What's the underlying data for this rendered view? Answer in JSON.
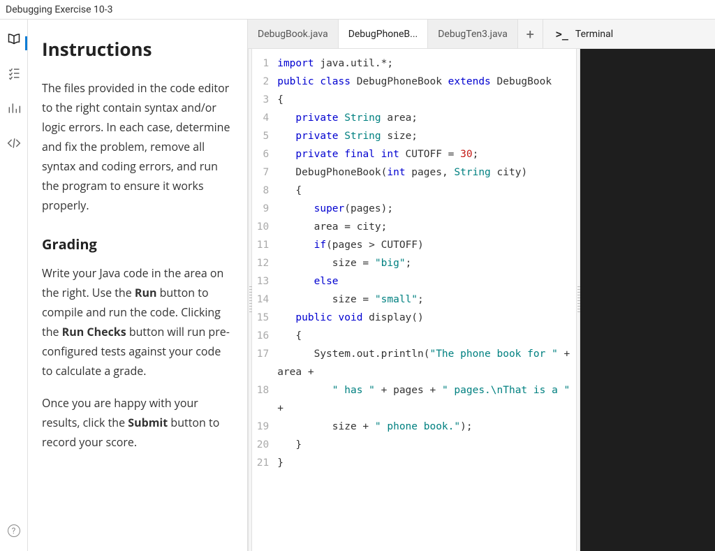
{
  "titlebar": {
    "title": "Debugging Exercise 10-3"
  },
  "iconbar": {
    "items": [
      "book",
      "checklist",
      "chart",
      "code"
    ]
  },
  "instructions": {
    "heading": "Instructions",
    "para1": "The files provided in the code editor to the right contain syntax and/or logic errors. In each case, determine and fix the problem, remove all syntax and coding errors, and run the program to ensure it works properly.",
    "grading_heading": "Grading",
    "para2_pre": "Write your Java code in the area on the right. Use the ",
    "para2_run": "Run",
    "para2_mid": " button to compile and run the code. Clicking the ",
    "para2_runchecks": "Run Checks",
    "para2_post": " button will run pre-configured tests against your code to calculate a grade.",
    "para3_pre": "Once you are happy with your results, click the ",
    "para3_submit": "Submit",
    "para3_post": " button to record your score."
  },
  "tabs": {
    "t1": "DebugBook.java",
    "t2": "DebugPhoneB...",
    "t3": "DebugTen3.java",
    "terminal": "Terminal"
  },
  "code": {
    "lines": [
      {
        "n": "1",
        "segs": [
          {
            "c": "kw",
            "t": "import"
          },
          {
            "c": "",
            "t": " java.util.*;"
          }
        ]
      },
      {
        "n": "2",
        "segs": [
          {
            "c": "kw",
            "t": "public class"
          },
          {
            "c": "",
            "t": " DebugPhoneBook "
          },
          {
            "c": "kw",
            "t": "extends"
          },
          {
            "c": "",
            "t": " DebugBook"
          }
        ]
      },
      {
        "n": "3",
        "segs": [
          {
            "c": "",
            "t": "{"
          }
        ]
      },
      {
        "n": "4",
        "segs": [
          {
            "c": "",
            "t": "   "
          },
          {
            "c": "kw",
            "t": "private"
          },
          {
            "c": "",
            "t": " "
          },
          {
            "c": "type",
            "t": "String"
          },
          {
            "c": "",
            "t": " area;"
          }
        ]
      },
      {
        "n": "5",
        "segs": [
          {
            "c": "",
            "t": "   "
          },
          {
            "c": "kw",
            "t": "private"
          },
          {
            "c": "",
            "t": " "
          },
          {
            "c": "type",
            "t": "String"
          },
          {
            "c": "",
            "t": " size;"
          }
        ]
      },
      {
        "n": "6",
        "segs": [
          {
            "c": "",
            "t": "   "
          },
          {
            "c": "kw",
            "t": "private final int"
          },
          {
            "c": "",
            "t": " CUTOFF = "
          },
          {
            "c": "num",
            "t": "30"
          },
          {
            "c": "",
            "t": ";"
          }
        ]
      },
      {
        "n": "7",
        "segs": [
          {
            "c": "",
            "t": "   DebugPhoneBook("
          },
          {
            "c": "kw",
            "t": "int"
          },
          {
            "c": "",
            "t": " pages, "
          },
          {
            "c": "type",
            "t": "String"
          },
          {
            "c": "",
            "t": " city)"
          }
        ]
      },
      {
        "n": "8",
        "segs": [
          {
            "c": "",
            "t": "   {"
          }
        ]
      },
      {
        "n": "9",
        "segs": [
          {
            "c": "",
            "t": "      "
          },
          {
            "c": "kw",
            "t": "super"
          },
          {
            "c": "",
            "t": "(pages);"
          }
        ]
      },
      {
        "n": "10",
        "segs": [
          {
            "c": "",
            "t": "      area = city;"
          }
        ]
      },
      {
        "n": "11",
        "segs": [
          {
            "c": "",
            "t": "      "
          },
          {
            "c": "kw",
            "t": "if"
          },
          {
            "c": "",
            "t": "(pages > CUTOFF)"
          }
        ]
      },
      {
        "n": "12",
        "segs": [
          {
            "c": "",
            "t": "         size = "
          },
          {
            "c": "str",
            "t": "\"big\""
          },
          {
            "c": "",
            "t": ";"
          }
        ]
      },
      {
        "n": "13",
        "segs": [
          {
            "c": "",
            "t": "      "
          },
          {
            "c": "kw",
            "t": "else"
          }
        ]
      },
      {
        "n": "14",
        "segs": [
          {
            "c": "",
            "t": "         size = "
          },
          {
            "c": "str",
            "t": "\"small\""
          },
          {
            "c": "",
            "t": ";"
          }
        ]
      },
      {
        "n": "15",
        "segs": [
          {
            "c": "",
            "t": "   "
          },
          {
            "c": "kw",
            "t": "public void"
          },
          {
            "c": "",
            "t": " display()"
          }
        ]
      },
      {
        "n": "16",
        "segs": [
          {
            "c": "",
            "t": "   {"
          }
        ]
      },
      {
        "n": "17",
        "segs": [
          {
            "c": "",
            "t": "      System.out.println("
          },
          {
            "c": "str",
            "t": "\"The phone book for \""
          },
          {
            "c": "",
            "t": " + "
          }
        ]
      },
      {
        "n": "",
        "segs": [
          {
            "c": "",
            "t": "area +"
          }
        ]
      },
      {
        "n": "18",
        "segs": [
          {
            "c": "",
            "t": "         "
          },
          {
            "c": "str",
            "t": "\" has \""
          },
          {
            "c": "",
            "t": " + pages + "
          },
          {
            "c": "str",
            "t": "\" pages.\\nThat is a \""
          },
          {
            "c": "",
            "t": " "
          }
        ]
      },
      {
        "n": "",
        "segs": [
          {
            "c": "",
            "t": "+"
          }
        ]
      },
      {
        "n": "19",
        "segs": [
          {
            "c": "",
            "t": "         size + "
          },
          {
            "c": "str",
            "t": "\" phone book.\""
          },
          {
            "c": "",
            "t": ");"
          }
        ]
      },
      {
        "n": "20",
        "segs": [
          {
            "c": "",
            "t": "   }"
          }
        ]
      },
      {
        "n": "21",
        "segs": [
          {
            "c": "",
            "t": "}"
          }
        ]
      }
    ]
  }
}
